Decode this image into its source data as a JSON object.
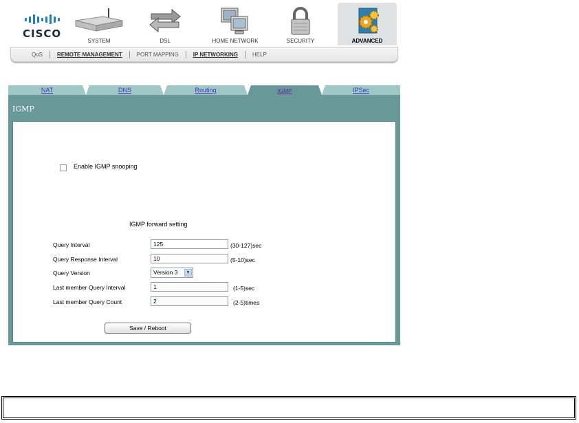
{
  "topnav": {
    "logo_text": "CISCO",
    "items": [
      {
        "label": "SYSTEM",
        "icon": "router-icon"
      },
      {
        "label": "DSL",
        "icon": "arrows-icon"
      },
      {
        "label": "HOME NETWORK",
        "icon": "computers-icon"
      },
      {
        "label": "SECURITY",
        "icon": "padlock-icon"
      },
      {
        "label": "ADVANCED",
        "icon": "gears-icon",
        "active": true
      }
    ],
    "subnav": [
      "QoS",
      "REMOTE MANAGEMENT",
      "PORT MAPPING",
      "IP NETWORKING",
      "HELP"
    ]
  },
  "tabs": [
    "NAT",
    "DNS",
    "Routing",
    "IGMP",
    "IPSec"
  ],
  "panel": {
    "title": "IGMP",
    "enable_label": "Enable IGMP snooping",
    "section_title": "IGMP forward setting",
    "fields": [
      {
        "label": "Query Interval",
        "value": "125",
        "hint": "(30-127)sec"
      },
      {
        "label": "Query Response Interval",
        "value": "10",
        "hint": "(5-10)sec"
      },
      {
        "label": "Query Version",
        "value": "Version 3"
      },
      {
        "label": "Last member Query Interval",
        "value": "1",
        "hint": "(1-5)sec"
      },
      {
        "label": "Last member Query Count",
        "value": "2",
        "hint": "(2-5)times"
      }
    ],
    "save_button": "Save / Reboot"
  },
  "colors": {
    "panel": "#689897",
    "tab": "#9ec7c6",
    "accent": "#1b7ec2"
  }
}
